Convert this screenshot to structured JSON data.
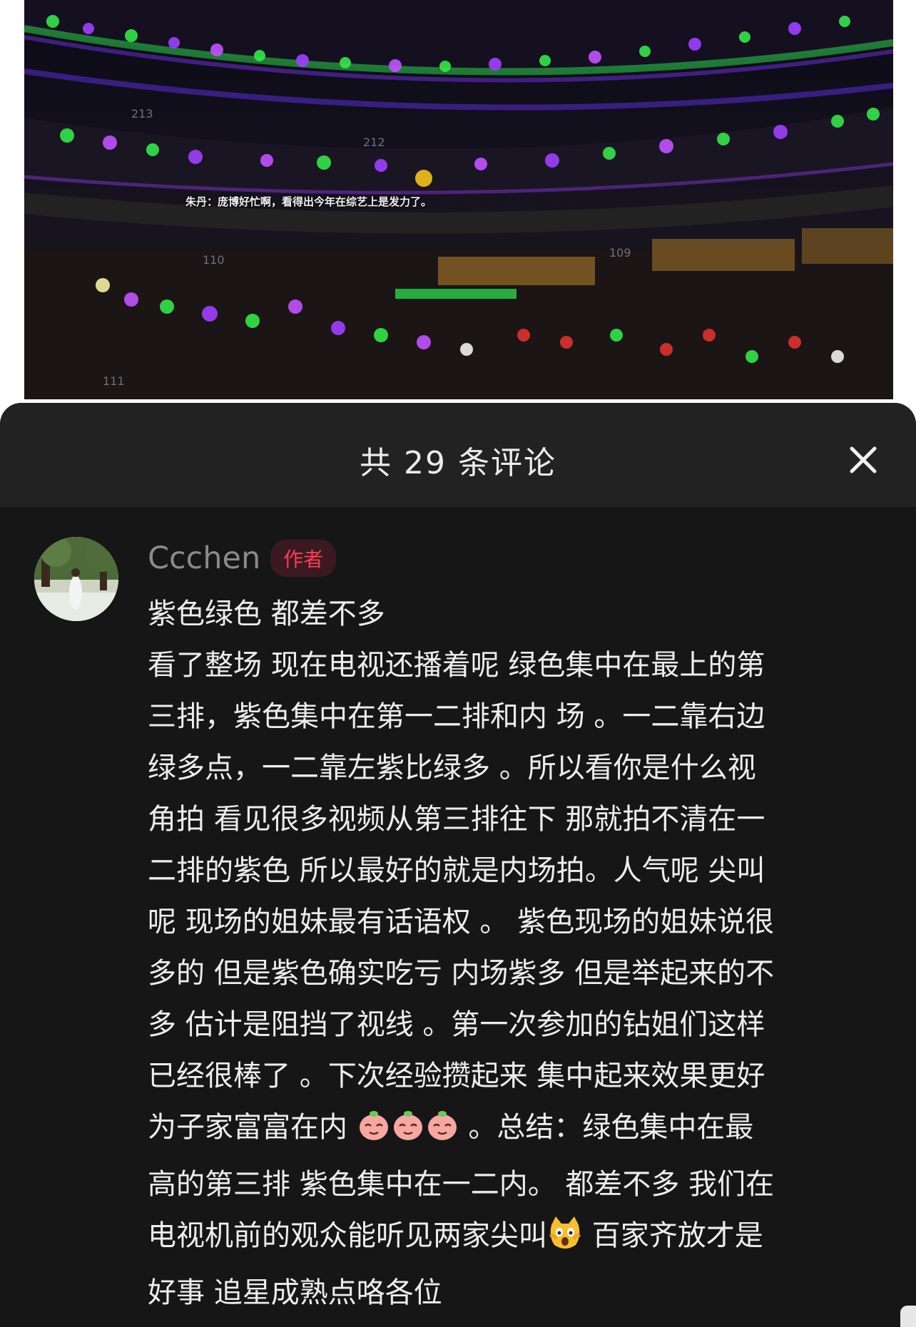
{
  "photo": {
    "subtitle": "朱丹：庞博好忙啊，看得出今年在综艺上是发力了。",
    "section_labels": [
      "213",
      "212",
      "110",
      "109",
      "111"
    ]
  },
  "sheet": {
    "title": "共 29 条评论",
    "close_icon": "close-icon"
  },
  "comment": {
    "author": "Ccchen",
    "badge": "作者",
    "lines": [
      "紫色绿色 都差不多",
      "看了整场 现在电视还播着呢 绿色集中在最上的第",
      "三排，紫色集中在第一二排和内 场 。一二靠右边",
      "绿多点，一二靠左紫比绿多 。所以看你是什么视",
      "角拍 看见很多视频从第三排往下 那就拍不清在一",
      "二排的紫色 所以最好的就是内场拍。人气呢 尖叫",
      "呢 现场的姐妹最有话语权 。 紫色现场的姐妹说很",
      "多的 但是紫色确实吃亏 内场紫多 但是举起来的不",
      "多 估计是阻挡了视线 。第一次参加的钻姐们这样",
      "已经很棒了 。下次经验攒起来 集中起来效果更好"
    ],
    "line11_before": "为子家富富在内",
    "line11_after": " 。总结：绿色集中在最",
    "line12": "高的第三排 紫色集中在一二内。 都差不多 我们在",
    "line13_before": "电视机前的观众能听见两家尖叫",
    "line13_after": " 百家齐放才是",
    "line14": "好事 追星成熟点咯各位",
    "emoji_icons": [
      "peach-face-emoji",
      "peach-face-emoji",
      "peach-face-emoji",
      "scared-cat-emoji"
    ]
  }
}
